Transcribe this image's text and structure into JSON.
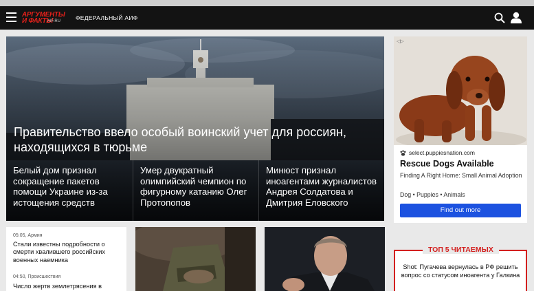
{
  "header": {
    "logo_line1": "АРГУМЕНТЫ",
    "logo_line2": "И ФАКТЫ",
    "logo_domain": "AIF.RU",
    "edition": "ФЕДЕРАЛЬНЫЙ АИФ",
    "icons": [
      "menu-icon",
      "search-icon",
      "user-icon"
    ],
    "colors": {
      "bar": "#131313",
      "brand": "#e0201a"
    }
  },
  "hero": {
    "title": "Правительство ввело особый воинский учет для россиян, находящихся в тюрьме",
    "sub": [
      "Белый дом признал сокращение пакетов помощи Украине из-за истощения средств",
      "Умер двукратный олимпийский чемпион по фигурному катанию Олег Протопопов",
      "Минюст признал иноагентами журналистов Андрея Солдатова и Дмитрия Еловского"
    ]
  },
  "ad": {
    "domain": "select.puppiesnation.com",
    "title": "Rescue Dogs Available",
    "desc": "Finding A Right Home: Small Animal Adoption",
    "tags": "Dog • Puppies • Animals",
    "button": "Find out more",
    "colors": {
      "button": "#1c52e0"
    }
  },
  "news_list": [
    {
      "time": "05:05",
      "rubric": "Армия",
      "title": "Стали известны подробности о смерти хвалившего российских военных наемника"
    },
    {
      "time": "04:50",
      "rubric": "Происшествия",
      "title": "Число жертв землетрясения в"
    }
  ],
  "top5": {
    "label": "ТОП 5 ЧИТАЕМЫХ",
    "item": "Shot: Пугачева вернулась в РФ решить вопрос со статусом иноагента у Галкина",
    "colors": {
      "accent": "#d3201f"
    }
  }
}
